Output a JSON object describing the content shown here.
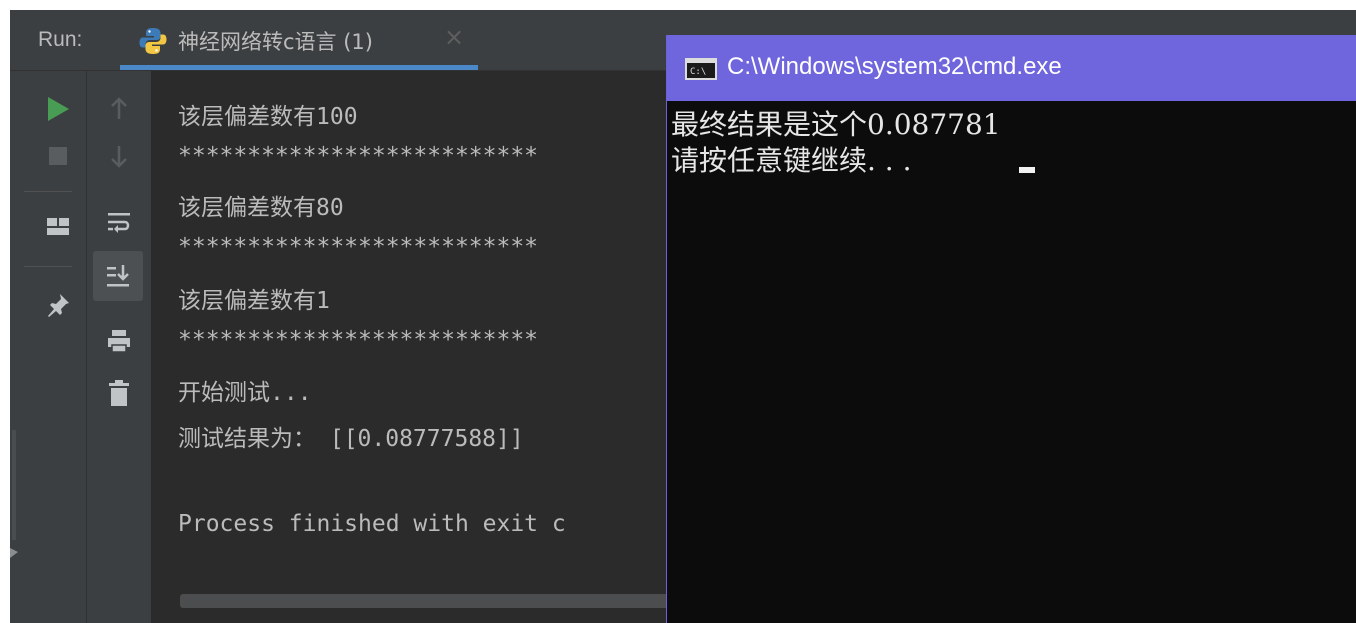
{
  "run_panel": {
    "label": "Run:",
    "tab": {
      "title": "神经网络转c语言 (1)",
      "close": "×"
    }
  },
  "console": {
    "lines": [
      "该层偏差数有100",
      "**************************",
      "该层偏差数有80",
      "**************************",
      "该层偏差数有1",
      "**************************",
      "开始测试...",
      "测试结果为：  [[0.08777588]]",
      "",
      "Process finished with exit c"
    ]
  },
  "cmd_window": {
    "title": "C:\\Windows\\system32\\cmd.exe",
    "lines": [
      "最终结果是这个0.087781",
      "请按任意键继续. . . "
    ]
  },
  "colors": {
    "ide_bg": "#2b2b2b",
    "toolbar_bg": "#3c3f41",
    "run_green": "#499c54",
    "cmd_titlebar": "#6f65dc",
    "cmd_bg": "#0c0c0c"
  },
  "icons": {
    "toolbar_left": [
      "run-icon",
      "stop-icon",
      "layout-icon",
      "pin-icon"
    ],
    "toolbar_right": [
      "up-arrow-icon",
      "down-arrow-icon",
      "soft-wrap-icon",
      "scroll-to-end-icon",
      "print-icon",
      "trash-icon"
    ]
  }
}
